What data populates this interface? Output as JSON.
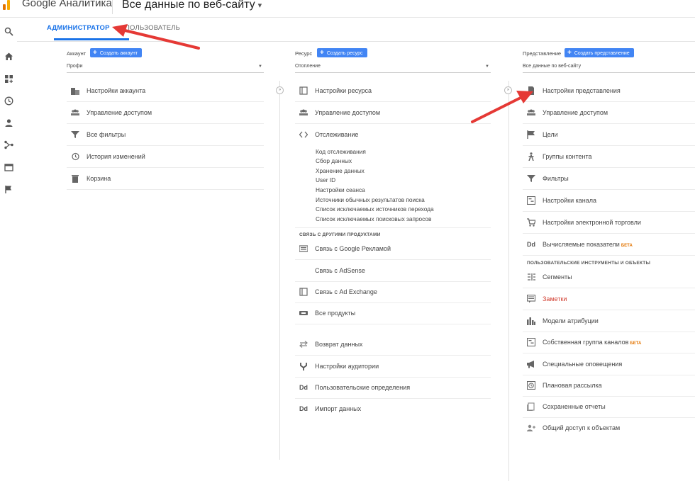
{
  "header": {
    "app_title": "Google Аналитика",
    "view_selector": "Все данные по веб-сайту"
  },
  "tabs": [
    {
      "label": "АДМИНИСТРАТОР",
      "active": true
    },
    {
      "label": "ПОЛЬЗОВАТЕЛЬ",
      "active": false
    }
  ],
  "account": {
    "heading": "Аккаунт",
    "create_label": "Создать аккаунт",
    "selected": "Профи",
    "items": [
      {
        "label": "Настройки аккаунта",
        "icon": "building-icon"
      },
      {
        "label": "Управление доступом",
        "icon": "people-icon"
      },
      {
        "label": "Все фильтры",
        "icon": "filter-icon"
      },
      {
        "label": "История изменений",
        "icon": "history-icon"
      },
      {
        "label": "Корзина",
        "icon": "trash-icon"
      }
    ]
  },
  "property": {
    "heading": "Ресурс",
    "create_label": "Создать ресурс",
    "selected": "Отопление",
    "items_top": [
      {
        "label": "Настройки ресурса",
        "icon": "window-icon"
      },
      {
        "label": "Управление доступом",
        "icon": "people-icon"
      },
      {
        "label": "Отслеживание",
        "icon": "code-icon"
      }
    ],
    "tracking_sub": [
      "Код отслеживания",
      "Сбор данных",
      "Хранение данных",
      "User ID",
      "Настройки сеанса",
      "Источники обычных результатов поиска",
      "Список исключаемых источников перехода",
      "Список исключаемых поисковых запросов"
    ],
    "links_section": "СВЯЗЬ С ДРУГИМИ ПРОДУКТАМИ",
    "items_links": [
      {
        "label": "Связь с Google Рекламой",
        "icon": "ads-icon"
      },
      {
        "label": "Связь с AdSense",
        "icon": ""
      },
      {
        "label": "Связь с Ad Exchange",
        "icon": "exchange-icon"
      },
      {
        "label": "Все продукты",
        "icon": "link-icon"
      }
    ],
    "items_bottom": [
      {
        "label": "Возврат данных",
        "icon": "return-icon"
      },
      {
        "label": "Настройки аудитории",
        "icon": "fork-icon"
      },
      {
        "label": "Пользовательские определения",
        "icon": "dd-icon"
      },
      {
        "label": "Импорт данных",
        "icon": "dd-icon"
      }
    ]
  },
  "view": {
    "heading": "Представление",
    "create_label": "Создать представление",
    "selected": "Все данные по веб-сайту",
    "items_top": [
      {
        "label": "Настройки представления",
        "icon": "document-icon"
      },
      {
        "label": "Управление доступом",
        "icon": "people-icon"
      },
      {
        "label": "Цели",
        "icon": "flag-icon"
      },
      {
        "label": "Группы контента",
        "icon": "person-walk-icon"
      },
      {
        "label": "Фильтры",
        "icon": "filter-icon"
      },
      {
        "label": "Настройки канала",
        "icon": "channel-icon"
      },
      {
        "label": "Настройки электронной торговли",
        "icon": "cart-icon"
      },
      {
        "label": "Вычисляемые показатели",
        "icon": "dd-icon",
        "badge": "БЕТА"
      }
    ],
    "tools_section": "ПОЛЬЗОВАТЕЛЬСКИЕ ИНСТРУМЕНТЫ И ОБЪЕКТЫ",
    "items_tools": [
      {
        "label": "Сегменты",
        "icon": "segments-icon"
      },
      {
        "label": "Заметки",
        "icon": "notes-icon"
      },
      {
        "label": "Модели атрибуции",
        "icon": "bars-icon"
      },
      {
        "label": "Собственная группа каналов",
        "icon": "channel-icon",
        "badge": "БЕТА"
      },
      {
        "label": "Специальные оповещения",
        "icon": "megaphone-icon"
      },
      {
        "label": "Плановая рассылка",
        "icon": "clock-icon"
      },
      {
        "label": "Сохраненные отчеты",
        "icon": "saved-icon"
      },
      {
        "label": "Общий доступ к объектам",
        "icon": "share-icon"
      }
    ]
  },
  "colors": {
    "accent": "#1a73e8",
    "button": "#4285f4",
    "annotation": "#e53935",
    "highlight_text": "#d23f31"
  }
}
